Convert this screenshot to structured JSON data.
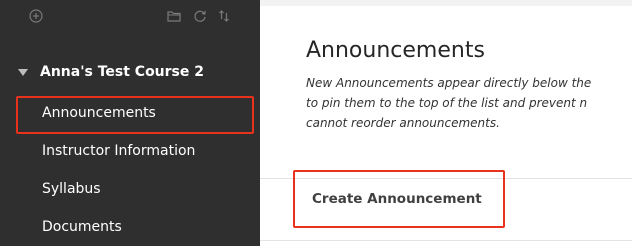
{
  "sidebar": {
    "toolbar_icons": [
      "add-icon",
      "folder-icon",
      "refresh-icon",
      "sort-icon"
    ],
    "course_title": "Anna's Test Course 2",
    "items": [
      {
        "label": "Announcements",
        "highlighted": true
      },
      {
        "label": "Instructor Information",
        "highlighted": false
      },
      {
        "label": "Syllabus",
        "highlighted": false
      },
      {
        "label": "Documents",
        "highlighted": false
      }
    ]
  },
  "main": {
    "title": "Announcements",
    "description_lines": [
      "New Announcements appear directly below the",
      "to pin them to the top of the list and prevent n",
      "cannot reorder announcements."
    ],
    "create_button_label": "Create Announcement"
  },
  "colors": {
    "sidebar_bg": "#2f2f2f",
    "highlight": "#e8321c",
    "text_dark": "#262626"
  }
}
